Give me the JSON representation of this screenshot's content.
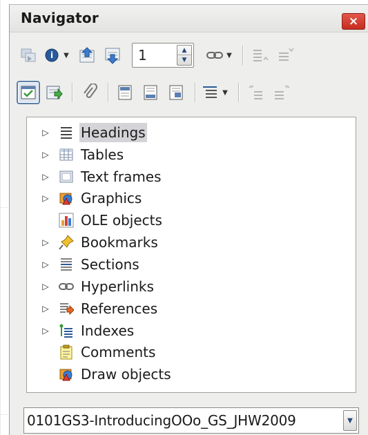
{
  "window": {
    "title": "Navigator",
    "close_glyph": "×"
  },
  "toolbar": {
    "page_number": "1"
  },
  "tree": {
    "items": [
      {
        "label": "Headings",
        "icon": "headings-icon",
        "expandable": true,
        "selected": true
      },
      {
        "label": "Tables",
        "icon": "tables-icon",
        "expandable": true
      },
      {
        "label": "Text frames",
        "icon": "text-frames-icon",
        "expandable": true
      },
      {
        "label": "Graphics",
        "icon": "graphics-icon",
        "expandable": true
      },
      {
        "label": "OLE objects",
        "icon": "ole-objects-icon",
        "expandable": false
      },
      {
        "label": "Bookmarks",
        "icon": "bookmarks-icon",
        "expandable": true
      },
      {
        "label": "Sections",
        "icon": "sections-icon",
        "expandable": true
      },
      {
        "label": "Hyperlinks",
        "icon": "hyperlinks-icon",
        "expandable": true
      },
      {
        "label": "References",
        "icon": "references-icon",
        "expandable": true
      },
      {
        "label": "Indexes",
        "icon": "indexes-icon",
        "expandable": true
      },
      {
        "label": "Comments",
        "icon": "comments-icon",
        "expandable": false
      },
      {
        "label": "Draw objects",
        "icon": "draw-objects-icon",
        "expandable": false
      }
    ]
  },
  "document_select": {
    "value": "0101GS3-IntroducingOOo_GS_JHW2009"
  },
  "colors": {
    "close_button": "#d3402f",
    "selection": "#d4d4d8",
    "window_bg": "#eeeeec"
  }
}
